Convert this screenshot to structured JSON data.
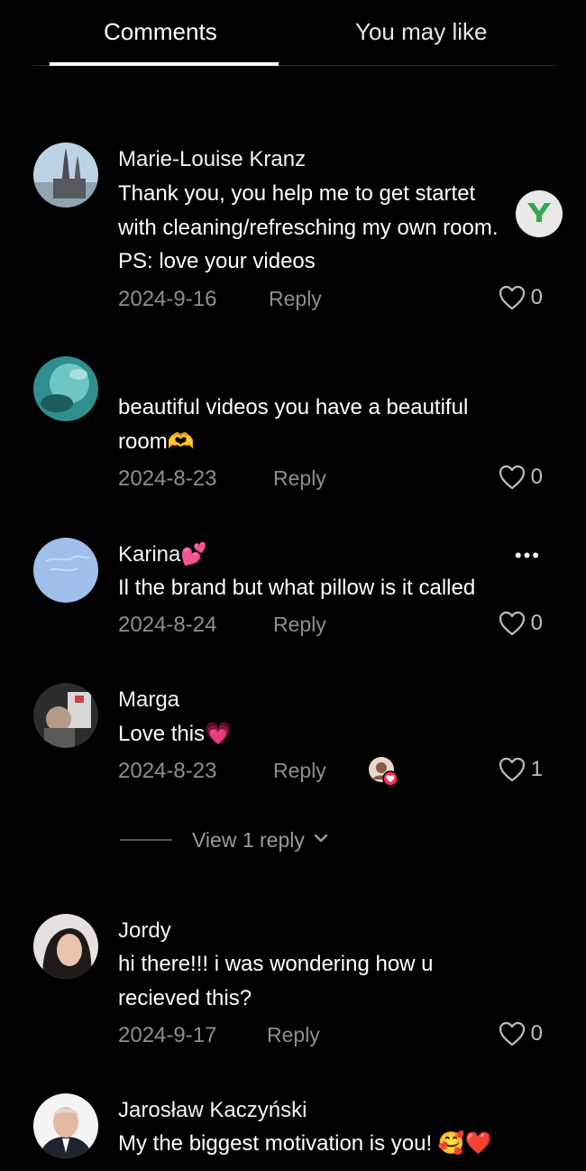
{
  "tabs": {
    "comments": "Comments",
    "you_may_like": "You may like"
  },
  "reply_label": "Reply",
  "comments": [
    {
      "username": "Marie-Louise Kranz",
      "lines": [
        "Thank you, you help me to get startet",
        "with cleaning/refresching my own room.",
        "PS: love your videos"
      ],
      "date": "2024-9-16",
      "likes": "0"
    },
    {
      "username": "",
      "lines": [
        "beautiful videos you have a beautiful",
        "room🫶"
      ],
      "date": "2024-8-23",
      "likes": "0"
    },
    {
      "username": "Karina💕",
      "lines": [
        "Il the brand but what pillow is it called"
      ],
      "date": "2024-8-24",
      "likes": "0",
      "more": "•••"
    },
    {
      "username": "Marga",
      "lines": [
        "Love this💗"
      ],
      "date": "2024-8-23",
      "likes": "1",
      "view_replies": "View 1 reply"
    },
    {
      "username": "Jordy",
      "lines": [
        "hi there!!! i was wondering how u",
        "recieved this?"
      ],
      "date": "2024-9-17",
      "likes": "0"
    },
    {
      "username": "Jarosław Kaczyński",
      "lines": [
        "My the biggest motivation is you! 🥰❤️"
      ]
    }
  ],
  "icons": {
    "like": "heart-outline-icon",
    "chevron": "chevron-down-icon",
    "badge": "y-logo-icon"
  },
  "colors": {
    "background": "#000000",
    "muted": "#8e8e8e",
    "badge_green": "#2fa84f"
  }
}
